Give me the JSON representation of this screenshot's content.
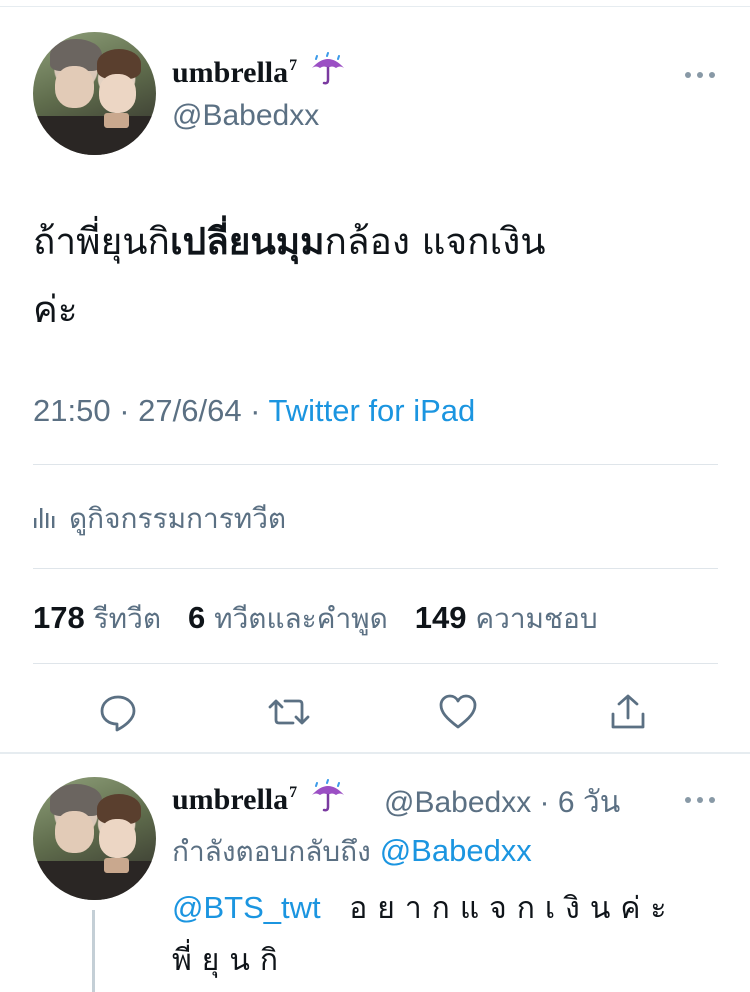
{
  "tweet": {
    "display_name": "umbrella",
    "name_sup": "7",
    "name_emoji_icon": "umbrella-with-rain-icon",
    "handle": "@Babedxx",
    "more_icon": "more-dots-icon",
    "body_part1": "ถ้าพี่ยุนกิ",
    "body_bold": "เปลี่ยนมุม",
    "body_part2": "กล้อง แจกเงิน",
    "body_part3": "ค่ะ",
    "time": "21:50 · 27/6/64 · ",
    "source": "Twitter for iPad",
    "activity_icon": "analytics-bars-icon",
    "activity_label": "ดูกิจกรรมการทวีต",
    "stats": [
      {
        "value": "178",
        "label": "รีทวีต"
      },
      {
        "value": "6",
        "label": "ทวีตและคำพูด"
      },
      {
        "value": "149",
        "label": "ความชอบ"
      }
    ],
    "actions": [
      "reply-icon",
      "retweet-icon",
      "like-icon",
      "share-icon"
    ]
  },
  "reply": {
    "display_name": "umbrella",
    "name_sup": "7",
    "handle_time": "@Babedxx · 6 วัน",
    "replying_label": "กำลังตอบกลับถึง ",
    "replying_handle": "@Babedxx",
    "mention": "@BTS_twt",
    "text_line1": "อยากแจกเงินค่ะ",
    "text_line2": "พี่ยุนกิ"
  },
  "colors": {
    "accent": "#1b95e0",
    "secondary_text": "#5b7083",
    "primary_text": "#0f1419",
    "divider": "#dfe5ea"
  }
}
